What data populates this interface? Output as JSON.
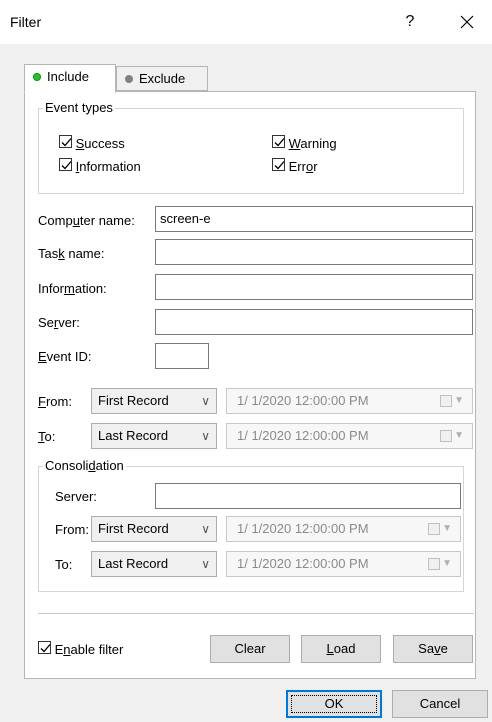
{
  "window": {
    "title": "Filter",
    "help": "?",
    "close": "✕"
  },
  "tabs": [
    {
      "label": "Include",
      "icon": "green-dot-icon",
      "color": "#22c02a",
      "active": true
    },
    {
      "label": "Exclude",
      "icon": "gray-dot-icon",
      "color": "#808080",
      "active": false
    }
  ],
  "event_types": {
    "legend": "Event types",
    "items": [
      {
        "pre": "",
        "ul": "S",
        "post": "uccess",
        "checked": true
      },
      {
        "pre": "",
        "ul": "W",
        "post": "arning",
        "checked": true
      },
      {
        "pre": "",
        "ul": "I",
        "post": "nformation",
        "checked": true
      },
      {
        "pre": "Err",
        "ul": "o",
        "post": "r",
        "checked": true
      }
    ]
  },
  "fields": {
    "computer": {
      "pre": "Comp",
      "ul": "u",
      "post": "ter name:",
      "value": "screen-e"
    },
    "task": {
      "pre": "Tas",
      "ul": "k",
      "post": " name:",
      "value": ""
    },
    "information": {
      "pre": "Infor",
      "ul": "m",
      "post": "ation:",
      "value": ""
    },
    "server": {
      "pre": "Se",
      "ul": "r",
      "post": "ver:",
      "value": ""
    },
    "event_id": {
      "pre": "",
      "ul": "E",
      "post": "vent ID:",
      "value": ""
    }
  },
  "range": {
    "from": {
      "pre": "",
      "ul": "F",
      "post": "rom:",
      "select": "First Record",
      "date": "1/  1/2020 12:00:00 PM"
    },
    "to": {
      "pre": "",
      "ul": "T",
      "post": "o:",
      "select": "Last Record",
      "date": "1/  1/2020 12:00:00 PM"
    }
  },
  "consolidation": {
    "legend_pre": "Consoli",
    "legend_ul": "d",
    "legend_post": "ation",
    "server_label": "Server:",
    "server_value": "",
    "from_label": "From:",
    "from_select": "First Record",
    "from_date": "1/  1/2020 12:00:00 PM",
    "to_label": "To:",
    "to_select": "Last Record",
    "to_date": "1/  1/2020 12:00:00 PM"
  },
  "footer": {
    "enable": {
      "pre": "E",
      "ul": "n",
      "post": "able filter",
      "checked": true
    },
    "clear": "Clear",
    "load_ul": "L",
    "load_post": "oad",
    "save_pre": "Sa",
    "save_ul": "v",
    "save_post": "e"
  },
  "dialog": {
    "ok": "OK",
    "cancel": "Cancel"
  }
}
